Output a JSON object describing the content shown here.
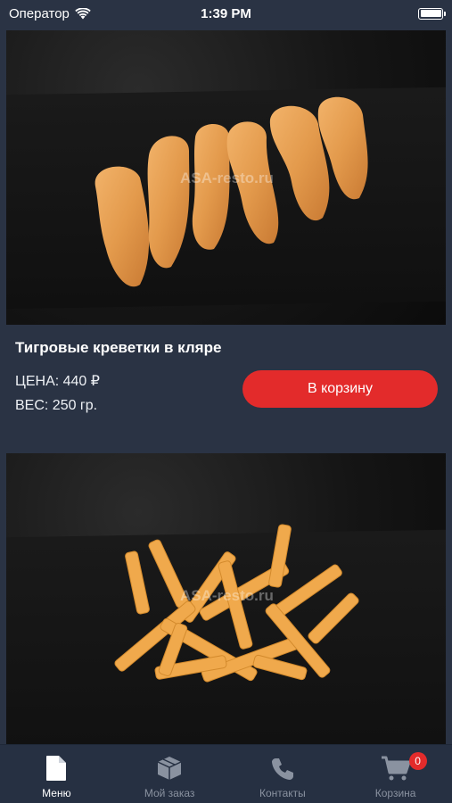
{
  "status_bar": {
    "carrier": "Оператор",
    "time": "1:39 PM"
  },
  "products": [
    {
      "title": "Тигровые креветки в кляре",
      "price": "ЦЕНА: 440 ₽",
      "weight": "ВЕС: 250 гр.",
      "button_label": "В корзину",
      "watermark": "ASA-resto.ru"
    },
    {
      "watermark": "ASA-resto.ru"
    }
  ],
  "tab_bar": {
    "tabs": [
      {
        "label": "Меню",
        "icon": "document-icon",
        "active": true
      },
      {
        "label": "Мой заказ",
        "icon": "box-icon",
        "active": false
      },
      {
        "label": "Контакты",
        "icon": "phone-icon",
        "active": false
      },
      {
        "label": "Корзина",
        "icon": "cart-icon",
        "active": false,
        "badge": "0"
      }
    ]
  },
  "colors": {
    "background": "#2a3344",
    "accent": "#e32b2b",
    "tab_inactive": "#8a92a0"
  }
}
